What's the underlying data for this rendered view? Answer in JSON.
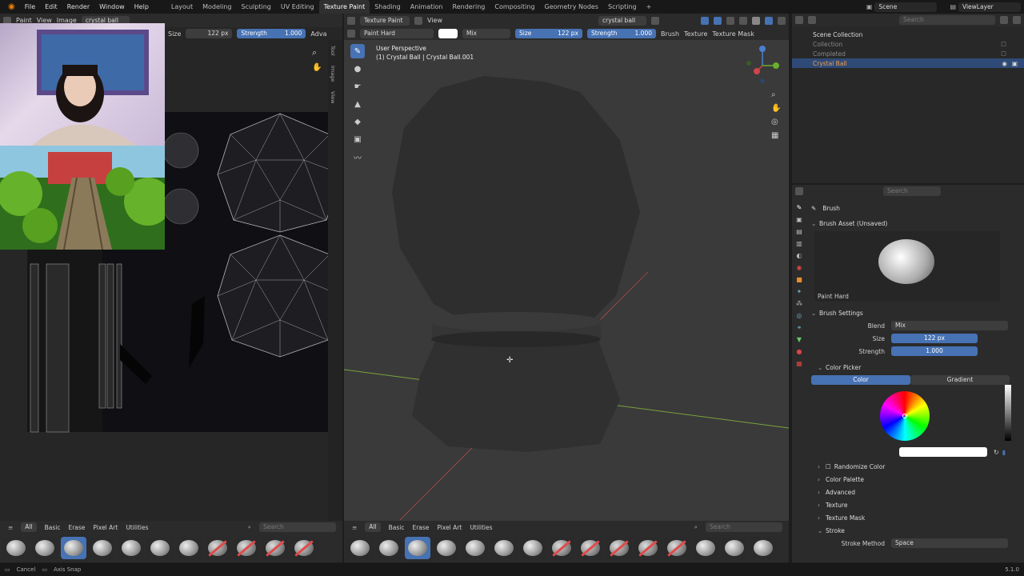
{
  "menus": [
    "File",
    "Edit",
    "Render",
    "Window",
    "Help"
  ],
  "workspaces": [
    "Layout",
    "Modeling",
    "Sculpting",
    "UV Editing",
    "Texture Paint",
    "Shading",
    "Animation",
    "Rendering",
    "Compositing",
    "Geometry Nodes",
    "Scripting",
    "+"
  ],
  "active_workspace": "Texture Paint",
  "scene": "Scene",
  "view_layer": "ViewLayer",
  "image_editor": {
    "mode": "Paint",
    "view_menu": "View",
    "image_menu": "Image",
    "image_name": "crystal ball",
    "size_label": "Size",
    "size_value": "122 px",
    "strength_label": "Strength",
    "strength_value": "1.000",
    "adv_label": "Adva",
    "side_tabs": [
      "Tool",
      "Image",
      "View"
    ],
    "brush_tabs": [
      "All",
      "Basic",
      "Erase",
      "Pixel Art",
      "Utilities"
    ],
    "search_placeholder": "Search"
  },
  "viewport": {
    "mode": "Texture Paint",
    "view_menu": "View",
    "object_name": "crystal ball",
    "brush_name": "Paint Hard",
    "blend": "Mix",
    "size_label": "Size",
    "size_value": "122 px",
    "strength_label": "Strength",
    "strength_value": "1.000",
    "menus": [
      "Brush",
      "Texture",
      "Texture Mask"
    ],
    "perspective": "User Perspective",
    "object_info": "(1) Crystal Ball | Crystal Ball.001",
    "brush_tabs": [
      "All",
      "Basic",
      "Erase",
      "Pixel Art",
      "Utilities"
    ],
    "search_placeholder": "Search"
  },
  "outliner": {
    "search_placeholder": "Search",
    "items": [
      {
        "label": "Scene Collection",
        "selected": false
      },
      {
        "label": "Collection",
        "selected": false
      },
      {
        "label": "Completed",
        "selected": false
      },
      {
        "label": "Crystal Ball",
        "selected": true
      }
    ]
  },
  "properties": {
    "search_placeholder": "Search",
    "title": "Brush",
    "asset_section": "Brush Asset (Unsaved)",
    "asset_name": "Paint Hard",
    "settings_section": "Brush Settings",
    "blend_label": "Blend",
    "blend_value": "Mix",
    "size_label": "Size",
    "size_value": "122 px",
    "strength_label": "Strength",
    "strength_value": "1.000",
    "color_picker_section": "Color Picker",
    "color_tab": "Color",
    "gradient_tab": "Gradient",
    "randomize_label": "Randomize Color",
    "collapsed_sections": [
      "Color Palette",
      "Advanced",
      "Texture",
      "Texture Mask"
    ],
    "stroke_section": "Stroke",
    "stroke_method_label": "Stroke Method",
    "stroke_method_value": "Space"
  },
  "status": {
    "cancel": "Cancel",
    "axis_snap": "Axis Snap",
    "version": "5.1.0"
  },
  "colors": {
    "accent": "#4772b3",
    "selected_text": "#f0a050",
    "active_row": "#2f4a77"
  }
}
